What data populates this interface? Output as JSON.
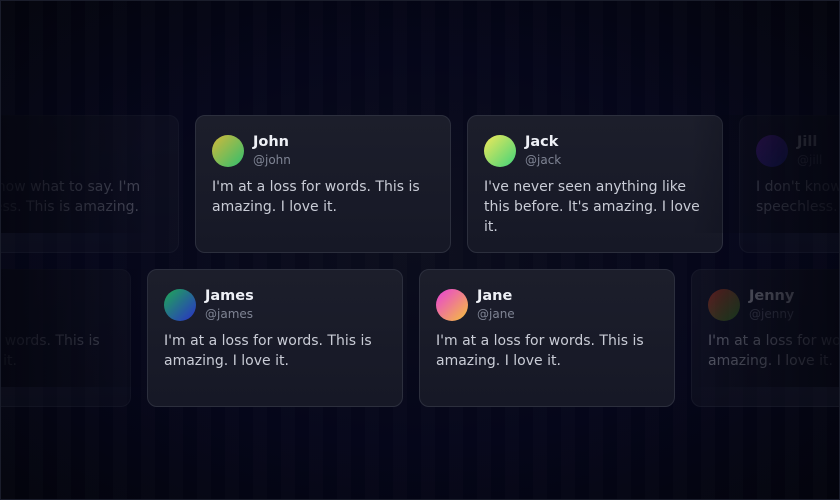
{
  "rows": [
    {
      "cards": [
        {
          "name": "",
          "handle": "",
          "text": "I don't know what to say. I'm speechless. This is amazing.",
          "avatar": [
            "#7b3fe4",
            "#2340a5"
          ]
        },
        {
          "name": "John",
          "handle": "@john",
          "text": "I'm at a loss for words. This is amazing. I love it.",
          "avatar": [
            "#d4b83a",
            "#2fbf6e"
          ]
        },
        {
          "name": "Jack",
          "handle": "@jack",
          "text": "I've never seen anything like this before. It's amazing. I love it.",
          "avatar": [
            "#f2e85a",
            "#3fd47a"
          ]
        },
        {
          "name": "Jill",
          "handle": "@jill",
          "text": "I don't know what to say. I'm speechless. This is amazing.",
          "avatar": [
            "#8a2bd6",
            "#2a3bc7"
          ]
        }
      ]
    },
    {
      "cards": [
        {
          "name": "",
          "handle": "",
          "text": "I'm at a loss for words. This is amazing. I love it.",
          "avatar": [
            "#c0264e",
            "#6a7a1f"
          ]
        },
        {
          "name": "James",
          "handle": "@james",
          "text": "I'm at a loss for words. This is amazing. I love it.",
          "avatar": [
            "#1faa55",
            "#2a2fc8"
          ]
        },
        {
          "name": "Jane",
          "handle": "@jane",
          "text": "I'm at a loss for words. This is amazing. I love it.",
          "avatar": [
            "#e83fd9",
            "#f5c23a"
          ]
        },
        {
          "name": "Jenny",
          "handle": "@jenny",
          "text": "I'm at a loss for words. This is amazing. I love it.",
          "avatar": [
            "#e03a2a",
            "#3a9a2a"
          ]
        }
      ]
    }
  ]
}
